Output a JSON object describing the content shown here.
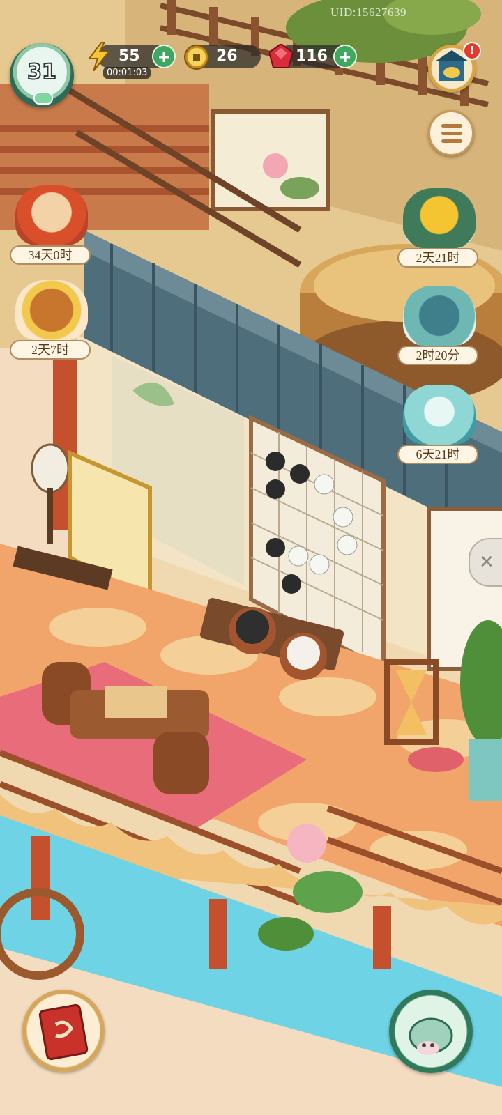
{
  "hud": {
    "uid": "UID:15627639",
    "level": "31",
    "energy": {
      "value": "55",
      "timer": "00:01:03",
      "plus": "+"
    },
    "coins": {
      "value": "26"
    },
    "gems": {
      "value": "116",
      "plus": "+"
    },
    "shop_alert": "!",
    "menu_icon": "list-icon"
  },
  "left_events": [
    {
      "name": "maple-letters-event",
      "timer": "34天0时"
    },
    {
      "name": "treasure-chest-event",
      "timer": "2天7时"
    }
  ],
  "right_events": [
    {
      "name": "chrysanthemum-event",
      "timer": "2天21时"
    },
    {
      "name": "jade-box-event",
      "timer": "2时20分"
    },
    {
      "name": "cat-gift-event",
      "timer": "6天21时"
    }
  ],
  "colors": {
    "roof": "#4f6e7b",
    "floor": "#f1a56b",
    "water": "#6fd3e6",
    "wood": "#a2552e",
    "hud_green": "#3ea860"
  }
}
